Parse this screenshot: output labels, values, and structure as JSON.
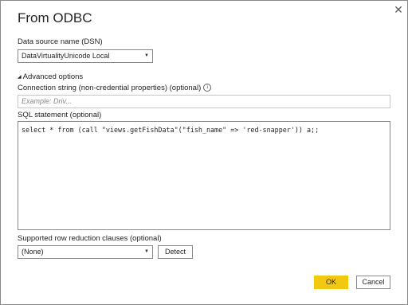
{
  "dialog": {
    "title": "From ODBC",
    "close_glyph": "✕"
  },
  "dsn": {
    "label": "Data source name (DSN)",
    "value": "DataVirtualityUnicode Local"
  },
  "advanced": {
    "label": "Advanced options"
  },
  "connection_string": {
    "label": "Connection string (non-credential properties) (optional)",
    "placeholder": "Example: Driv..."
  },
  "sql": {
    "label": "SQL statement (optional)",
    "value": "select * from (call \"views.getFishData\"(\"fish_name\" => 'red-snapper')) a;;"
  },
  "row_reduction": {
    "label": "Supported row reduction clauses (optional)",
    "value": "(None)"
  },
  "buttons": {
    "detect": "Detect",
    "ok": "OK",
    "cancel": "Cancel"
  },
  "colors": {
    "ok_button": "#f2c811"
  }
}
